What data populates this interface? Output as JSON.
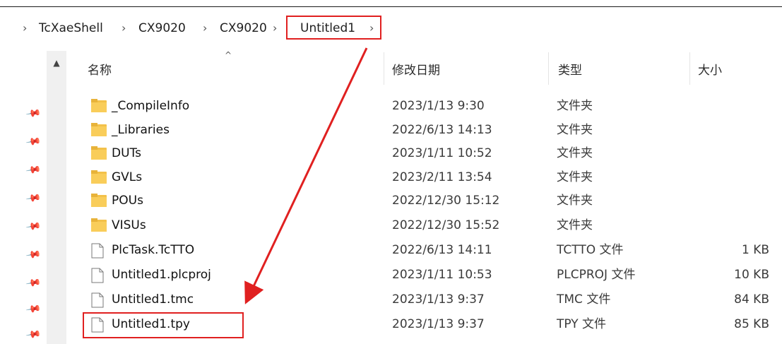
{
  "breadcrumb": {
    "items": [
      "TcXaeShell",
      "CX9020",
      "CX9020",
      "Untitled1"
    ]
  },
  "columns": {
    "name": "名称",
    "modified": "修改日期",
    "type": "类型",
    "size": "大小"
  },
  "files": [
    {
      "name": "_CompileInfo",
      "date": "2023/1/13 9:30",
      "type": "文件夹",
      "size": "",
      "icon": "folder-icon"
    },
    {
      "name": "_Libraries",
      "date": "2022/6/13 14:13",
      "type": "文件夹",
      "size": "",
      "icon": "folder-icon"
    },
    {
      "name": "DUTs",
      "date": "2023/1/11 10:52",
      "type": "文件夹",
      "size": "",
      "icon": "folder-icon"
    },
    {
      "name": "GVLs",
      "date": "2023/2/11 13:54",
      "type": "文件夹",
      "size": "",
      "icon": "folder-icon"
    },
    {
      "name": "POUs",
      "date": "2022/12/30 15:12",
      "type": "文件夹",
      "size": "",
      "icon": "folder-icon"
    },
    {
      "name": "VISUs",
      "date": "2022/12/30 15:52",
      "type": "文件夹",
      "size": "",
      "icon": "folder-icon"
    },
    {
      "name": "PlcTask.TcTTO",
      "date": "2022/6/13 14:11",
      "type": "TCTTO 文件",
      "size": "1 KB",
      "icon": "file-icon"
    },
    {
      "name": "Untitled1.plcproj",
      "date": "2023/1/11 10:53",
      "type": "PLCPROJ 文件",
      "size": "10 KB",
      "icon": "file-icon"
    },
    {
      "name": "Untitled1.tmc",
      "date": "2023/1/13 9:37",
      "type": "TMC 文件",
      "size": "84 KB",
      "icon": "file-icon"
    },
    {
      "name": "Untitled1.tpy",
      "date": "2023/1/13 9:37",
      "type": "TPY 文件",
      "size": "85 KB",
      "icon": "file-icon"
    }
  ],
  "colors": {
    "highlight": "#e02020",
    "folder": "#f8c94d"
  }
}
